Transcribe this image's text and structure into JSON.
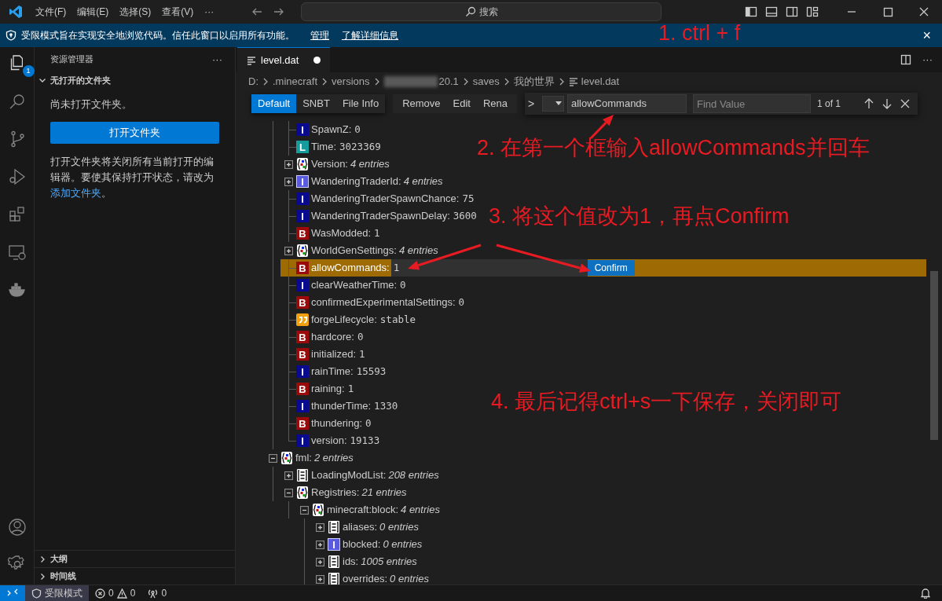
{
  "title_bar": {
    "menus": [
      "文件(F)",
      "编辑(E)",
      "选择(S)",
      "查看(V)",
      "···"
    ],
    "search_placeholder": "搜索"
  },
  "banner": {
    "text": "受限模式旨在实现安全地浏览代码。信任此窗口以启用所有功能。",
    "links": [
      "管理",
      "了解详细信息"
    ],
    "close": "×"
  },
  "activity_bar": {
    "explorer_badge": "1"
  },
  "sidebar": {
    "title": "资源管理器",
    "more": "···",
    "section": "无打开的文件夹",
    "message": "尚未打开文件夹。",
    "button": "打开文件夹",
    "hint": "打开文件夹将关闭所有当前打开的编辑器。要使其保持打开状态，请改为",
    "hint_link": "添加文件夹",
    "hint_end": "。",
    "panels": [
      "大纲",
      "时间线"
    ]
  },
  "tab": {
    "label": "level.dat",
    "modified": true
  },
  "breadcrumb": {
    "segments": [
      "D:",
      ".minecraft",
      "versions",
      "20.1",
      "saves",
      "我的世界"
    ],
    "file": "level.dat"
  },
  "toolbar": {
    "views": [
      {
        "label": "Default",
        "selected": true
      },
      {
        "label": "SNBT",
        "selected": false
      },
      {
        "label": "File Info",
        "selected": false
      }
    ],
    "actions": [
      "Remove",
      "Edit",
      "Rena"
    ]
  },
  "find": {
    "chevron": ">",
    "value": "allowCommands",
    "placeholder": "Find Value",
    "count": "1 of 1"
  },
  "tree": [
    {
      "children": [
        {
          "kind": "int",
          "badge": "I",
          "label": "SpawnZ:",
          "value": "0",
          "selected": false
        },
        {
          "kind": "long",
          "badge": "L",
          "label": "Time:",
          "value": "3023369",
          "selected": false
        },
        {
          "kind": "compound",
          "label": "Version:",
          "entries": "4 entries",
          "expanded": false,
          "selected": false
        },
        {
          "kind": "int_array",
          "badge": "I",
          "label": "WanderingTraderId:",
          "entries": "4 entries",
          "expanded": false,
          "selected": false
        },
        {
          "kind": "int",
          "badge": "I",
          "label": "WanderingTraderSpawnChance:",
          "value": "75",
          "selected": false
        },
        {
          "kind": "int",
          "badge": "I",
          "label": "WanderingTraderSpawnDelay:",
          "value": "3600",
          "selected": false
        },
        {
          "kind": "byte",
          "badge": "B",
          "label": "WasModded:",
          "value": "1",
          "selected": false
        },
        {
          "kind": "compound",
          "label": "WorldGenSettings:",
          "entries": "4 entries",
          "expanded": false,
          "selected": false
        },
        {
          "kind": "byte",
          "badge": "B",
          "label": "allowCommands:",
          "selected": true,
          "edit": {
            "value": "1",
            "button": "Confirm"
          }
        },
        {
          "kind": "int",
          "badge": "I",
          "label": "clearWeatherTime:",
          "value": "0",
          "selected": false
        },
        {
          "kind": "byte",
          "badge": "B",
          "label": "confirmedExperimentalSettings:",
          "value": "0",
          "selected": false
        },
        {
          "kind": "string",
          "label": "forgeLifecycle:",
          "value": "stable",
          "selected": false
        },
        {
          "kind": "byte",
          "badge": "B",
          "label": "hardcore:",
          "value": "0",
          "selected": false
        },
        {
          "kind": "byte",
          "badge": "B",
          "label": "initialized:",
          "value": "1",
          "selected": false
        },
        {
          "kind": "int",
          "badge": "I",
          "label": "rainTime:",
          "value": "15593",
          "selected": false
        },
        {
          "kind": "byte",
          "badge": "B",
          "label": "raining:",
          "value": "1",
          "selected": false
        },
        {
          "kind": "int",
          "badge": "I",
          "label": "thunderTime:",
          "value": "1330",
          "selected": false
        },
        {
          "kind": "byte",
          "badge": "B",
          "label": "thundering:",
          "value": "0",
          "selected": false
        },
        {
          "kind": "int",
          "badge": "I",
          "label": "version:",
          "value": "19133",
          "selected": false
        }
      ]
    },
    {
      "kind": "compound",
      "label": "fml:",
      "entries": "2 entries",
      "expanded": true,
      "selected": false,
      "children": [
        {
          "kind": "list",
          "label": "LoadingModList:",
          "entries": "208 entries",
          "expanded": false,
          "selected": false
        },
        {
          "kind": "compound",
          "label": "Registries:",
          "entries": "21 entries",
          "expanded": true,
          "selected": false,
          "children": [
            {
              "kind": "compound",
              "label": "minecraft:block:",
              "entries": "4 entries",
              "expanded": true,
              "selected": false,
              "children": [
                {
                  "kind": "list",
                  "label": "aliases:",
                  "entries": "0 entries",
                  "expanded": false,
                  "selected": false
                },
                {
                  "kind": "int_array",
                  "badge": "I",
                  "label": "blocked:",
                  "entries": "0 entries",
                  "expanded": false,
                  "selected": false
                },
                {
                  "kind": "list",
                  "label": "ids:",
                  "entries": "1005 entries",
                  "expanded": false,
                  "selected": false
                },
                {
                  "kind": "list",
                  "label": "overrides:",
                  "entries": "0 entries",
                  "expanded": false,
                  "selected": false
                }
              ]
            }
          ]
        }
      ]
    }
  ],
  "annotations": [
    {
      "text": "1. ctrl + f"
    },
    {
      "text": "2. 在第一个框输入allowCommands并回车"
    },
    {
      "text": "3. 将这个值改为1，再点Confirm"
    },
    {
      "text": "4. 最后记得ctrl+s一下保存，关闭即可"
    }
  ],
  "status_bar": {
    "mode": "受限模式",
    "errors": "0",
    "warnings": "0",
    "ports": "0"
  }
}
